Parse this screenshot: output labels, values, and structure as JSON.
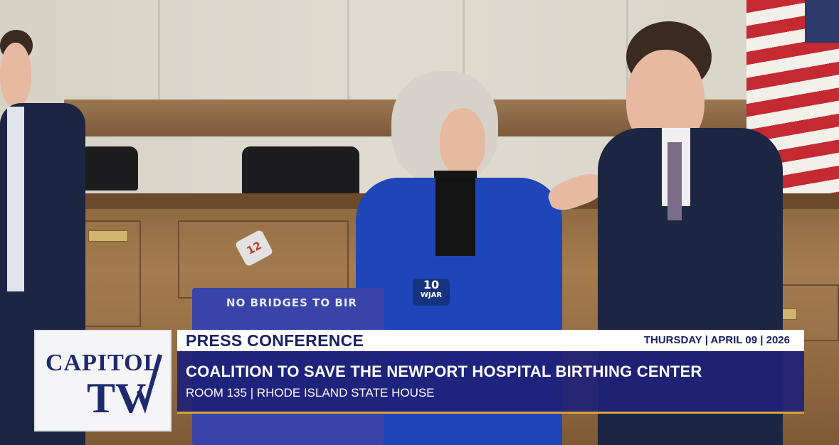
{
  "logo": {
    "line1": "CAPITOL",
    "line2": "TV"
  },
  "lower_third": {
    "label": "PRESS CONFERENCE",
    "date": "THURSDAY | APRIL 09 | 2026",
    "title": "COALITION TO SAVE THE NEWPORT HOSPITAL BIRTHING CENTER",
    "subtitle": "ROOM 135 | RHODE ISLAND STATE HOUSE"
  },
  "scene": {
    "podium_sign": "NO BRIDGES TO BIR",
    "mic_flag_channel": "10",
    "mic_flag_callsign": "WJAR",
    "mic_flag_2": "12"
  },
  "colors": {
    "overlay_navy": "#1e2178",
    "label_text": "#1a2066",
    "accent_gold": "#d5a23a"
  }
}
